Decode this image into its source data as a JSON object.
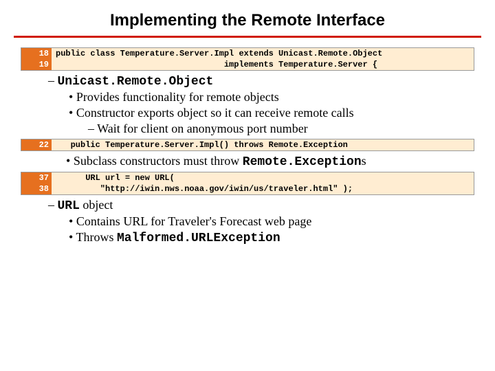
{
  "title": "Implementing the Remote Interface",
  "code1": {
    "l18n": "18",
    "l18": "public class Temperature.Server.Impl extends Unicast.Remote.Object",
    "l19n": "19",
    "l19": "                                  implements Temperature.Server {"
  },
  "b1": {
    "heading": "Unicast.Remote.Object",
    "p1": "Provides functionality for remote objects",
    "p2": "Constructor exports object so it can receive remote calls",
    "sub": "Wait for client on anonymous port number"
  },
  "code2": {
    "l22n": "22",
    "l22": "   public Temperature.Server.Impl() throws Remote.Exception"
  },
  "b2": {
    "p1_pre": "Subclass constructors must throw ",
    "p1_mono": "Remote.Exception",
    "p1_suf": "s"
  },
  "code3": {
    "l37n": "37",
    "l37": "      URL url = new URL(",
    "l38n": "38",
    "l38": "         \"http://iwin.nws.noaa.gov/iwin/us/traveler.html\" );"
  },
  "b3": {
    "heading_mono": "URL",
    "heading_rest": " object",
    "p1": "Contains URL for Traveler's Forecast web page",
    "p2_pre": "Throws ",
    "p2_mono": "Malformed.URLException"
  }
}
